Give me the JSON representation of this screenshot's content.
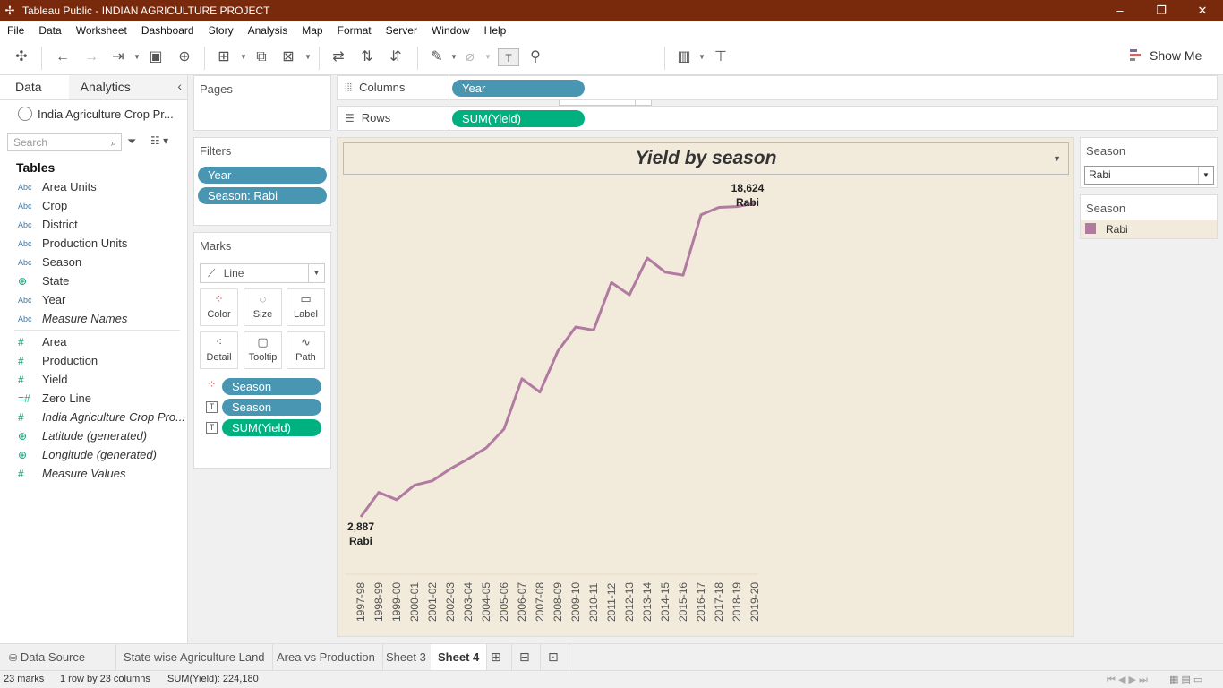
{
  "window": {
    "title": "Tableau Public - INDIAN AGRICULTURE PROJECT"
  },
  "menu": [
    "File",
    "Data",
    "Worksheet",
    "Dashboard",
    "Story",
    "Analysis",
    "Map",
    "Format",
    "Server",
    "Window",
    "Help"
  ],
  "toolbar": {
    "fit_select": "Standard",
    "show_me": "Show Me"
  },
  "left_pane": {
    "tab_data": "Data",
    "tab_analytics": "Analytics",
    "datasource": "India Agriculture Crop Pr...",
    "search_placeholder": "Search",
    "tables_heading": "Tables",
    "dimensions": [
      {
        "type": "Abc",
        "name": "Area Units"
      },
      {
        "type": "Abc",
        "name": "Crop"
      },
      {
        "type": "Abc",
        "name": "District"
      },
      {
        "type": "Abc",
        "name": "Production Units"
      },
      {
        "type": "Abc",
        "name": "Season"
      },
      {
        "type": "globe",
        "name": "State"
      },
      {
        "type": "Abc",
        "name": "Year"
      },
      {
        "type": "Abc",
        "name": "Measure Names"
      }
    ],
    "measures": [
      {
        "type": "#",
        "name": "Area"
      },
      {
        "type": "#",
        "name": "Production"
      },
      {
        "type": "#",
        "name": "Yield"
      },
      {
        "type": "=#",
        "name": "Zero Line"
      },
      {
        "type": "#",
        "name": "India Agriculture Crop Pro..."
      },
      {
        "type": "globe",
        "name": "Latitude (generated)"
      },
      {
        "type": "globe",
        "name": "Longitude (generated)"
      },
      {
        "type": "#",
        "name": "Measure Values"
      }
    ]
  },
  "pages": {
    "title": "Pages"
  },
  "filters": {
    "title": "Filters",
    "pills": [
      "Year",
      "Season: Rabi"
    ]
  },
  "marks": {
    "title": "Marks",
    "type": "Line",
    "buttons": [
      "Color",
      "Size",
      "Label",
      "Detail",
      "Tooltip",
      "Path"
    ],
    "pills": [
      {
        "icon": "color",
        "label": "Season",
        "color": "blue"
      },
      {
        "icon": "label",
        "label": "Season",
        "color": "blue"
      },
      {
        "icon": "label",
        "label": "SUM(Yield)",
        "color": "green"
      }
    ]
  },
  "shelves": {
    "columns_label": "Columns",
    "columns_pill": "Year",
    "rows_label": "Rows",
    "rows_pill": "SUM(Yield)"
  },
  "chart_data": {
    "type": "line",
    "title": "Yield by season",
    "categories": [
      "1997-98",
      "1998-99",
      "1999-00",
      "2000-01",
      "2001-02",
      "2002-03",
      "2003-04",
      "2004-05",
      "2005-06",
      "2006-07",
      "2007-08",
      "2008-09",
      "2009-10",
      "2010-11",
      "2011-12",
      "2012-13",
      "2013-14",
      "2014-15",
      "2015-16",
      "2016-17",
      "2017-18",
      "2018-19",
      "2019-20"
    ],
    "series": [
      {
        "name": "Rabi",
        "color": "#b07aa1",
        "values": [
          2887,
          4120,
          3750,
          4480,
          4700,
          5300,
          5800,
          6350,
          7300,
          9820,
          9150,
          11200,
          12420,
          12260,
          14650,
          14030,
          15880,
          15170,
          15020,
          18050,
          18420,
          18460,
          18624
        ]
      }
    ],
    "ylim": [
      0,
      19000
    ],
    "labels": {
      "first_value": "2,887",
      "first_series": "Rabi",
      "last_value": "18,624",
      "last_series": "Rabi"
    }
  },
  "season_filter": {
    "title": "Season",
    "value": "Rabi"
  },
  "legend": {
    "title": "Season",
    "items": [
      {
        "label": "Rabi",
        "color": "#b07aa1"
      }
    ]
  },
  "sheets": {
    "data_source": "Data Source",
    "tabs": [
      "State wise Agriculture Land",
      "Area vs Production",
      "Sheet 3",
      "Sheet 4"
    ],
    "active": "Sheet 4"
  },
  "status": {
    "marks": "23 marks",
    "rows_cols": "1 row by 23 columns",
    "sum": "SUM(Yield): 224,180"
  }
}
